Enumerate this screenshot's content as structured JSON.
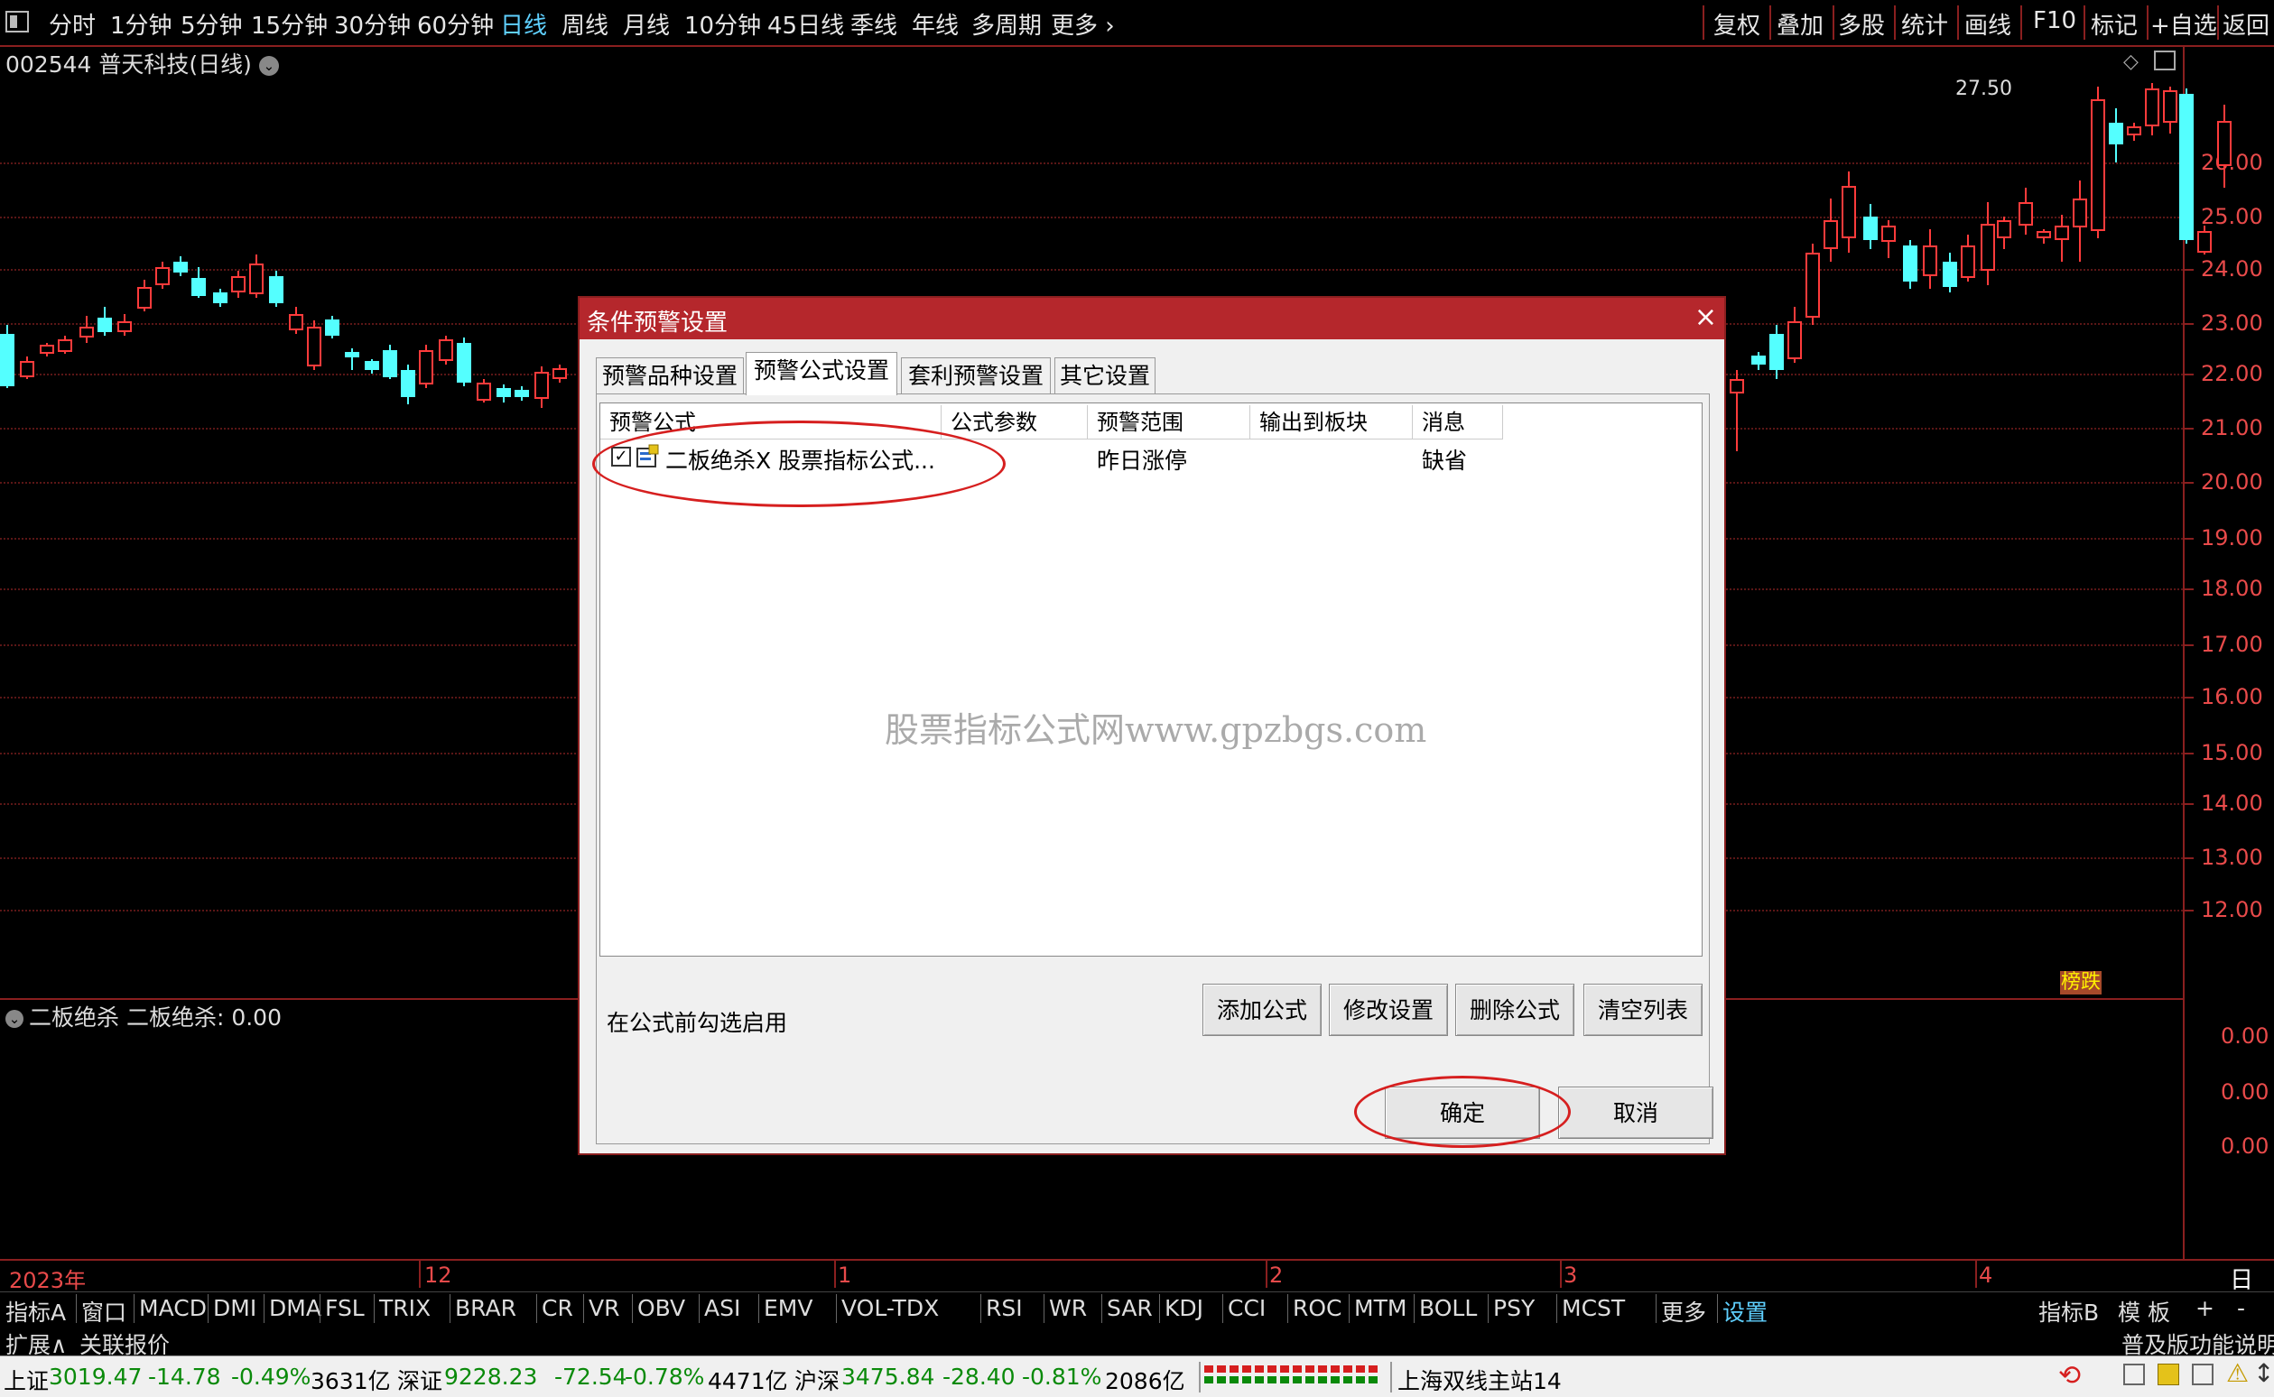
{
  "toolbar": {
    "timeframes": [
      "分时",
      "1分钟",
      "5分钟",
      "15分钟",
      "30分钟",
      "60分钟",
      "日线",
      "周线",
      "月线",
      "10分钟",
      "45日线",
      "季线",
      "年线",
      "多周期",
      "更多"
    ],
    "active_timeframe": "日线",
    "right_buttons": [
      "复权",
      "叠加",
      "多股",
      "统计",
      "画线",
      "F10",
      "标记",
      "+自选",
      "返回"
    ]
  },
  "chart": {
    "stock_title": "002544 普天科技(日线)",
    "price_labels": [
      "26.00",
      "25.00",
      "24.00",
      "23.00",
      "22.00",
      "21.00",
      "20.00",
      "19.00",
      "18.00",
      "17.00",
      "16.00",
      "15.00",
      "14.00",
      "13.00",
      "12.00"
    ],
    "peak_label": "27.50",
    "rise_badge": "榜跌",
    "date_labels": [
      "2023年",
      "12",
      "1",
      "2",
      "3",
      "4"
    ],
    "period_label": "日线",
    "colors": {
      "up": "#ff3b3b",
      "down": "#54ffff",
      "axis": "#8a1f1f"
    }
  },
  "indicator": {
    "title": "二板绝杀  二板绝杀: 0.00",
    "values": [
      "0.00",
      "0.00",
      "0.00"
    ]
  },
  "indicator_tabs": [
    "指标A",
    "窗口",
    "MACD",
    "DMI",
    "DMA",
    "FSL",
    "TRIX",
    "BRAR",
    "CR",
    "VR",
    "OBV",
    "ASI",
    "EMV",
    "VOL-TDX",
    "RSI",
    "WR",
    "SAR",
    "KDJ",
    "CCI",
    "ROC",
    "MTM",
    "BOLL",
    "PSY",
    "MCST",
    "更多",
    "设置"
  ],
  "indicator_tabs_active": "设置",
  "indicator_right": [
    "指标B",
    "模 板",
    "+",
    "-"
  ],
  "ext_row": {
    "left": [
      "扩展∧",
      "关联报价"
    ],
    "right": "普及版功能说明"
  },
  "status_bar": {
    "sh": {
      "name": "上证",
      "value": "3019.47",
      "change": "-14.78",
      "pct": "-0.49%",
      "amount": "3631亿"
    },
    "sz": {
      "name": "深证",
      "value": "9228.23",
      "change": "-72.54",
      "pct": "-0.78%",
      "amount": "4471亿"
    },
    "hs": {
      "name": "沪深",
      "value": "3475.84",
      "change": "-28.40",
      "pct": "-0.81%",
      "amount": "2086亿"
    },
    "server": "上海双线主站14"
  },
  "dialog": {
    "title": "条件预警设置",
    "tabs": [
      "预警品种设置",
      "预警公式设置",
      "套利预警设置",
      "其它设置"
    ],
    "active_tab": "预警公式设置",
    "columns": [
      "预警公式",
      "公式参数",
      "预警范围",
      "输出到板块",
      "消息"
    ],
    "rows": [
      {
        "checked": true,
        "formula": "二板绝杀X 股票指标公式...",
        "params": "",
        "range": "昨日涨停",
        "output": "",
        "message": "缺省"
      }
    ],
    "hint": "在公式前勾选启用",
    "buttons": {
      "add": "添加公式",
      "modify": "修改设置",
      "delete": "删除公式",
      "clear": "清空列表",
      "ok": "确定",
      "cancel": "取消"
    }
  },
  "watermark": "股票指标公式网www.gpzbgs.com"
}
